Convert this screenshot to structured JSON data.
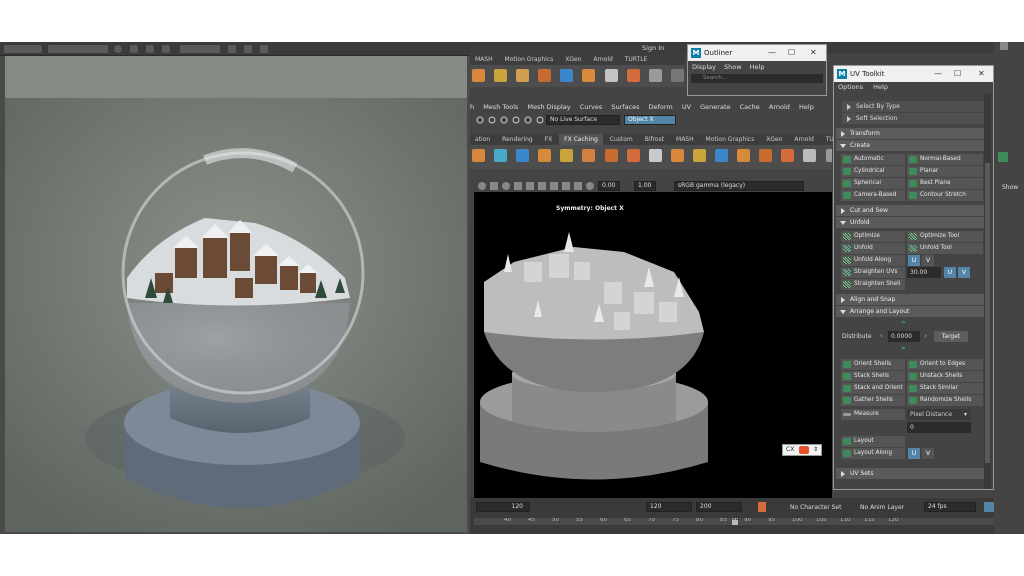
{
  "outliner": {
    "title": "Outliner",
    "menu": [
      "Display",
      "Show",
      "Help"
    ],
    "search_placeholder": "Search..."
  },
  "top_menu": {
    "sign_in": "Sign In",
    "shelf_tabs_top": [
      "MASH",
      "Motion Graphics",
      "XGen",
      "Arnold",
      "TURTLE"
    ]
  },
  "maya": {
    "menu": [
      "h",
      "Mesh Tools",
      "Mesh Display",
      "Curves",
      "Surfaces",
      "Deform",
      "UV",
      "Generate",
      "Cache",
      "Arnold",
      "Help"
    ],
    "live_surface": "No Live Surface",
    "object_mode": "Object X",
    "shelf_tabs": [
      "ation",
      "Rendering",
      "FX",
      "FX Caching",
      "Custom",
      "Bifrost",
      "MASH",
      "Motion Graphics",
      "XGen",
      "Arnold",
      "TURTLE"
    ],
    "shelf_active": "FX Caching",
    "vp_exposure": "0.00",
    "vp_gamma": "1.00",
    "color_space": "sRGB gamma (legacy)",
    "symmetry": "Symmetry: Object X",
    "camera": "persp",
    "cx_label": "CX",
    "timeline_ticks": [
      "40",
      "45",
      "50",
      "55",
      "60",
      "65",
      "70",
      "75",
      "80",
      "85",
      "90",
      "95",
      "100",
      "105",
      "110",
      "115",
      "120"
    ],
    "current_frame": "88",
    "range_end": "120",
    "range_field_1": "120",
    "range_field_2": "200",
    "character_set": "No Character Set",
    "anim_layer": "No Anim Layer",
    "fps": "24 fps"
  },
  "right_sliver": {
    "show": "Show"
  },
  "uvtk": {
    "title": "UV Toolkit",
    "menu": [
      "Options",
      "Help"
    ],
    "select_by_type": "Select By Type",
    "soft_selection": "Soft Selection",
    "transform": "Transform",
    "create": "Create",
    "automatic": "Automatic",
    "normal_based": "Normal-Based",
    "cylindrical": "Cylindrical",
    "planar": "Planar",
    "spherical": "Spherical",
    "best_plane": "Best Plane",
    "camera_based": "Camera-Based",
    "contour_stretch": "Contour Stretch",
    "cut_and_sew": "Cut and Sew",
    "unfold": "Unfold",
    "optimize": "Optimize",
    "optimize_tool": "Optimize Tool",
    "unfold_btn": "Unfold",
    "unfold_tool": "Unfold Tool",
    "unfold_along": "Unfold Along",
    "u": "U",
    "v": "V",
    "straighten_uvs": "Straighten UVs",
    "straighten_value": "30.00",
    "straighten_shell": "Straighten Shell",
    "align_and_snap": "Align and Snap",
    "arrange_and_layout": "Arrange and Layout",
    "distribute": "Distribute",
    "distribute_value": "0.0000",
    "target": "Target",
    "orient_shells": "Orient Shells",
    "orient_to_edges": "Orient to Edges",
    "stack_shells": "Stack Shells",
    "unstack_shells": "Unstack Shells",
    "stack_and_orient": "Stack and Orient",
    "stack_similar": "Stack Similar",
    "gather_shells": "Gather Shells",
    "randomize_shells": "Randomize Shells",
    "measure": "Measure",
    "pixel_distance": "Pixel Distance",
    "measure_value": "0",
    "layout": "Layout",
    "layout_along": "Layout Along",
    "uv_sets": "UV Sets"
  }
}
